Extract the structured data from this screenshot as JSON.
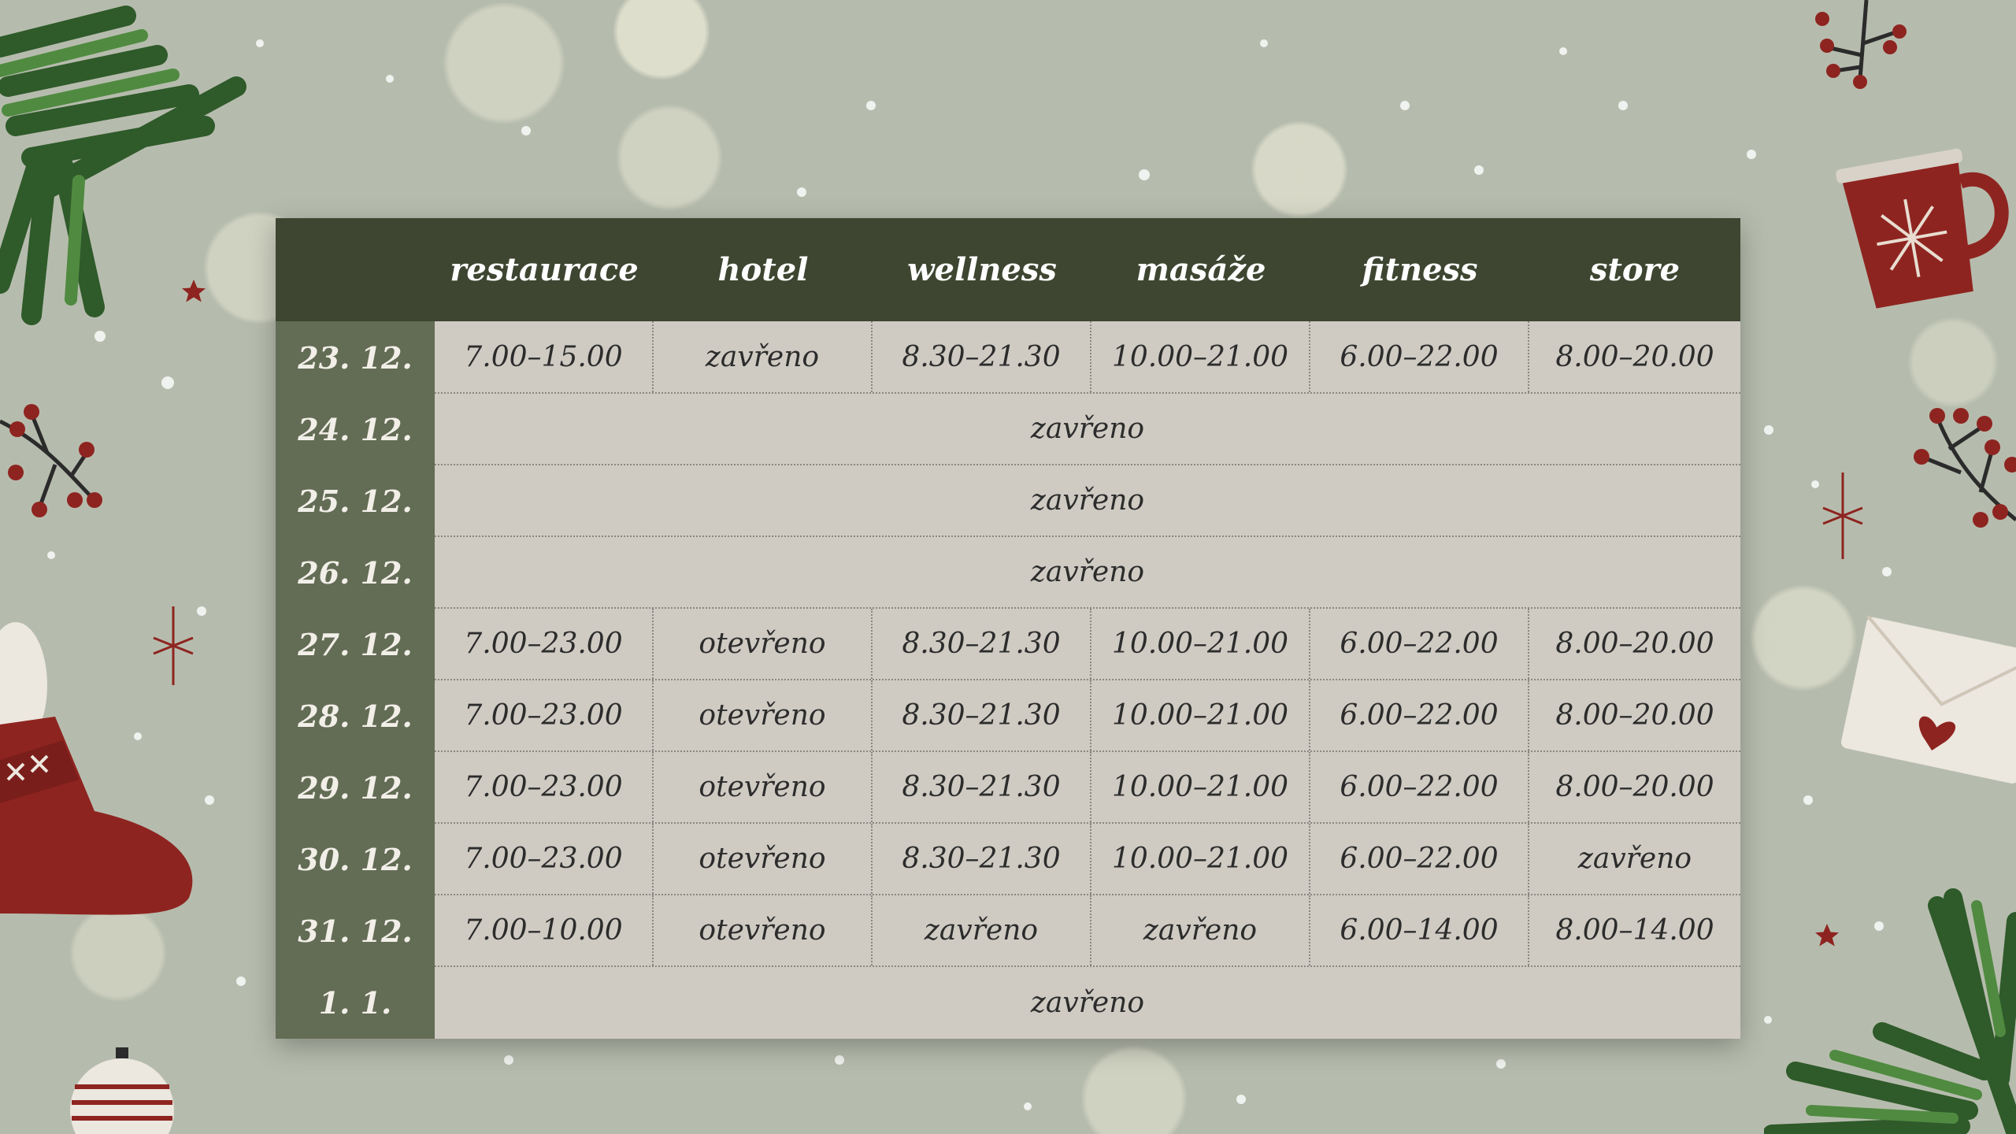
{
  "table": {
    "columns": [
      "restaurace",
      "hotel",
      "wellness",
      "masáže",
      "fitness",
      "store"
    ],
    "rows": [
      {
        "date": "23. 12.",
        "cells": [
          "7.00–15.00",
          "zavřeno",
          "8.30–21.30",
          "10.00–21.00",
          "6.00–22.00",
          "8.00–20.00"
        ]
      },
      {
        "date": "24. 12.",
        "all": "zavřeno"
      },
      {
        "date": "25. 12.",
        "all": "zavřeno"
      },
      {
        "date": "26. 12.",
        "all": "zavřeno"
      },
      {
        "date": "27. 12.",
        "cells": [
          "7.00–23.00",
          "otevřeno",
          "8.30–21.30",
          "10.00–21.00",
          "6.00–22.00",
          "8.00–20.00"
        ]
      },
      {
        "date": "28. 12.",
        "cells": [
          "7.00–23.00",
          "otevřeno",
          "8.30–21.30",
          "10.00–21.00",
          "6.00–22.00",
          "8.00–20.00"
        ]
      },
      {
        "date": "29. 12.",
        "cells": [
          "7.00–23.00",
          "otevřeno",
          "8.30–21.30",
          "10.00–21.00",
          "6.00–22.00",
          "8.00–20.00"
        ]
      },
      {
        "date": "30. 12.",
        "cells": [
          "7.00–23.00",
          "otevřeno",
          "8.30–21.30",
          "10.00–21.00",
          "6.00–22.00",
          "zavřeno"
        ]
      },
      {
        "date": "31. 12.",
        "cells": [
          "7.00–10.00",
          "otevřeno",
          "zavřeno",
          "zavřeno",
          "6.00–14.00",
          "8.00–14.00"
        ]
      },
      {
        "date": "1. 1.",
        "all": "zavřeno"
      }
    ]
  },
  "colors": {
    "background": "#b6bcad",
    "header": "#3e4631",
    "date_column": "#636c55",
    "cells": "#cfcbc3",
    "accent_red": "#8e2420",
    "pine_green": "#3c6b34"
  },
  "decorations": [
    "pine-branch",
    "berry-sprig",
    "mug-with-snowflake",
    "envelope-with-heart",
    "red-sock",
    "ornament-bauble",
    "star",
    "sparkle"
  ]
}
